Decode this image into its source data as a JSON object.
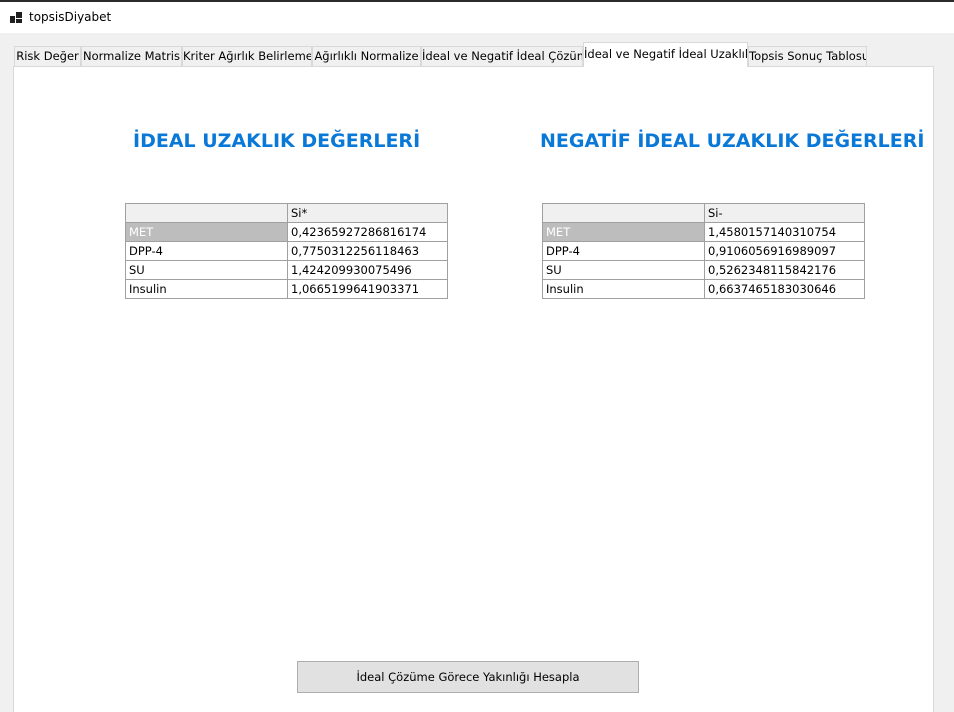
{
  "window": {
    "title": "topsisDiyabet",
    "icon": "app-window-icon"
  },
  "tabs": [
    {
      "label": "Risk Değer"
    },
    {
      "label": "Normalize Matris"
    },
    {
      "label": "Kriter Ağırlık Belirleme"
    },
    {
      "label": "Ağırlıklı Normalize"
    },
    {
      "label": "İdeal ve Negatif İdeal Çözüm"
    },
    {
      "label": "İdeal ve Negatif İdeal Uzaklık",
      "active": true
    },
    {
      "label": "Topsis Sonuç Tablosu"
    }
  ],
  "ideal": {
    "heading": "İDEAL UZAKLIK DEĞERLERİ",
    "column_header": "Si*",
    "rows": [
      {
        "name": "MET",
        "value": "0,42365927286816174",
        "selected": true
      },
      {
        "name": "DPP-4",
        "value": "0,7750312256118463"
      },
      {
        "name": "SU",
        "value": "1,424209930075496"
      },
      {
        "name": "Insulin",
        "value": "1,0665199641903371"
      }
    ]
  },
  "negative": {
    "heading": "NEGATİF İDEAL UZAKLIK DEĞERLERİ",
    "column_header": "Si-",
    "rows": [
      {
        "name": "MET",
        "value": "1,4580157140310754",
        "selected": true
      },
      {
        "name": "DPP-4",
        "value": "0,9106056916989097"
      },
      {
        "name": "SU",
        "value": "0,5262348115842176"
      },
      {
        "name": "Insulin",
        "value": "0,6637465183030646"
      }
    ]
  },
  "action_button": {
    "label": "İdeal Çözüme Görece Yakınlığı Hesapla"
  },
  "colors": {
    "heading": "#0a78d7",
    "selected_row": "#bdbdbd"
  }
}
